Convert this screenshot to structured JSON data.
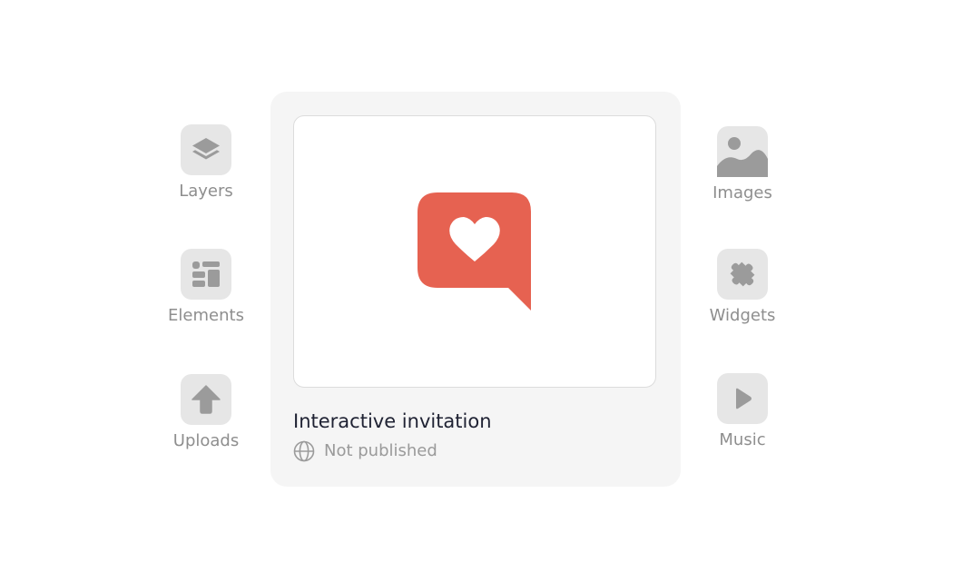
{
  "tools_left": [
    {
      "id": "layers",
      "label": "Layers",
      "icon": "layers-icon"
    },
    {
      "id": "elements",
      "label": "Elements",
      "icon": "elements-icon"
    },
    {
      "id": "uploads",
      "label": "Uploads",
      "icon": "upload-arrow-icon"
    }
  ],
  "tools_right": [
    {
      "id": "images",
      "label": "Images",
      "icon": "image-icon"
    },
    {
      "id": "widgets",
      "label": "Widgets",
      "icon": "puzzle-icon"
    },
    {
      "id": "music",
      "label": "Music",
      "icon": "play-icon"
    }
  ],
  "card": {
    "title": "Interactive invitation",
    "status": "Not published",
    "status_icon": "globe-icon",
    "preview_icon": "heart-speech-bubble-icon",
    "accent_color": "#e66251"
  },
  "colors": {
    "tile_bg": "#e6e6e6",
    "icon_gray": "#9b9b9b",
    "label_gray": "#8e8e8e",
    "card_bg": "#f5f5f5"
  }
}
